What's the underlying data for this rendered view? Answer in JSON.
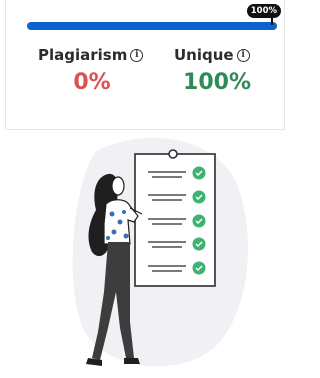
{
  "progress": {
    "badge": "100%",
    "fraction": 1.0,
    "color": "#0d63c9"
  },
  "stats": {
    "plagiarism": {
      "label": "Plagiarism",
      "value": "0%",
      "color": "#d9534f"
    },
    "unique": {
      "label": "Unique",
      "value": "100%",
      "color": "#2e8b57"
    }
  },
  "icons": {
    "info": "info-icon",
    "check": "check-icon"
  },
  "illustration": {
    "check_color": "#3cb371"
  }
}
